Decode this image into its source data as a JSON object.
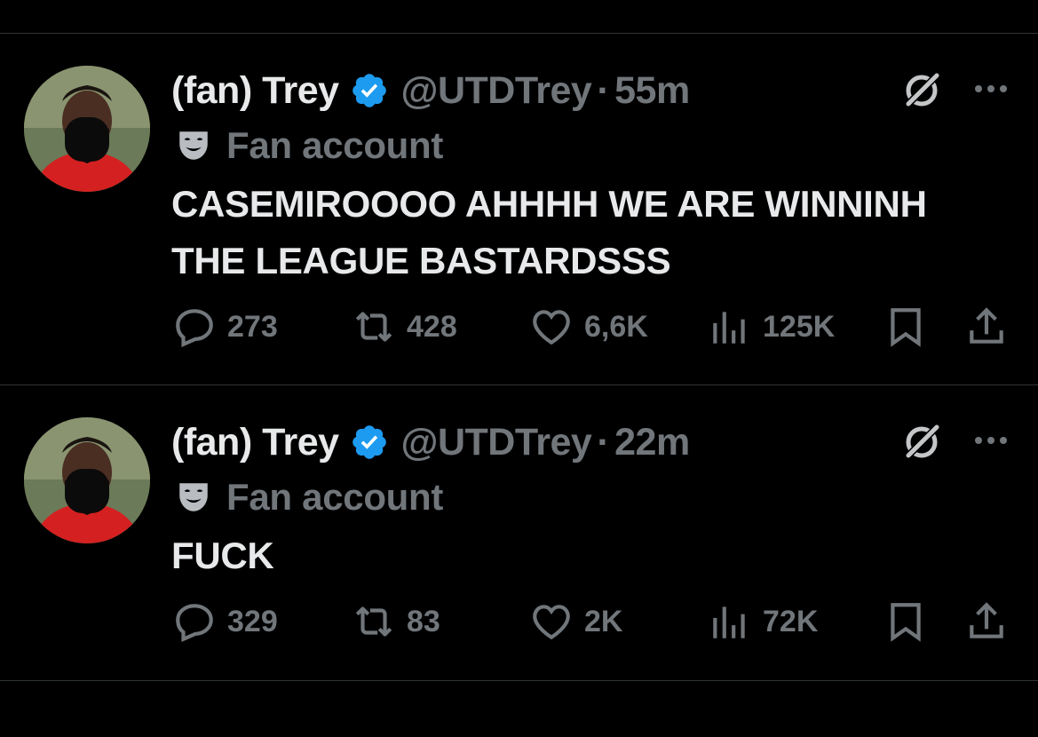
{
  "colors": {
    "background": "#000000",
    "divider": "#2f3336",
    "primary_text": "#e7e9ea",
    "secondary_text": "#71767b",
    "verified": "#1d9bf0"
  },
  "tweets": [
    {
      "author_name": "(fan) Trey",
      "handle": "@UTDTrey",
      "separator": "·",
      "time": "55m",
      "label": "Fan account",
      "text": "CASEMIROOOO AHHHH WE ARE WINNINH THE LEAGUE BASTARDSSS",
      "replies": "273",
      "reposts": "428",
      "likes": "6,6K",
      "views": "125K"
    },
    {
      "author_name": "(fan) Trey",
      "handle": "@UTDTrey",
      "separator": "·",
      "time": "22m",
      "label": "Fan account",
      "text": "FUCK",
      "replies": "329",
      "reposts": "83",
      "likes": "2K",
      "views": "72K"
    }
  ],
  "icons": [
    "verified-badge-icon",
    "grok-icon",
    "more-icon",
    "theater-mask-icon",
    "reply-icon",
    "repost-icon",
    "like-icon",
    "views-icon",
    "bookmark-icon",
    "share-icon"
  ]
}
